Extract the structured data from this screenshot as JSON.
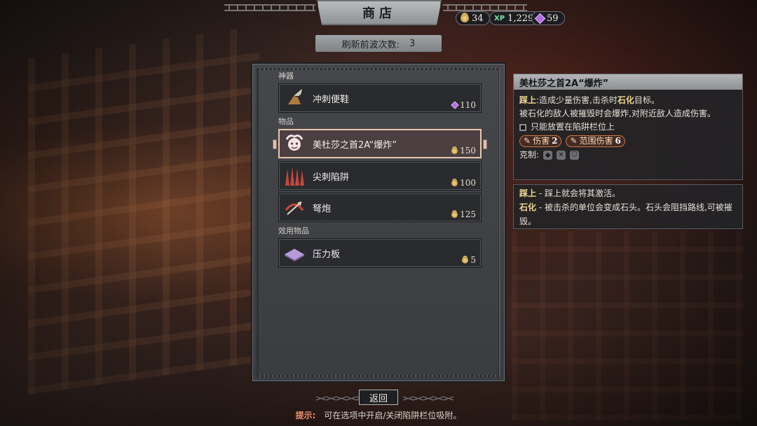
{
  "header": {
    "title": "商店",
    "wave_label": "刷新前波次数:",
    "wave_count": "3"
  },
  "currencies": {
    "gold": "34",
    "xp_label": "XP",
    "xp": "1,229",
    "gems": "59"
  },
  "shop": {
    "sections": [
      {
        "label": "神器"
      },
      {
        "label": "物品"
      },
      {
        "label": "效用物品"
      }
    ],
    "items": [
      {
        "name": "冲刺便鞋",
        "price": "110",
        "currency": "gem",
        "icon": "winged-sandal-icon"
      },
      {
        "name": "美杜莎之首2A“爆炸”",
        "price": "150",
        "currency": "gold",
        "icon": "medusa-head-icon"
      },
      {
        "name": "尖刺陷阱",
        "price": "100",
        "currency": "gold",
        "icon": "spike-trap-icon"
      },
      {
        "name": "弩炮",
        "price": "125",
        "currency": "gold",
        "icon": "ballista-icon"
      },
      {
        "name": "压力板",
        "price": "5",
        "currency": "gold",
        "icon": "pressure-plate-icon"
      }
    ],
    "selected_index": 1
  },
  "tooltip": {
    "title": "美杜莎之首2A“爆炸”",
    "line1_kw": "踩上",
    "line1_a": ":造成少量伤害,击杀时",
    "line1_kw2": "石化",
    "line1_b": "目标。",
    "line2": "被石化的敌人被摧毁时会爆炸,对附近敌人造成伤害。",
    "note": "只能放置在陷阱栏位上",
    "tags": [
      {
        "label": "伤害",
        "value": "2"
      },
      {
        "label": "范围伤害",
        "value": "6"
      }
    ],
    "counter_label": "克制:"
  },
  "glossary": {
    "entries": [
      {
        "term": "踩上",
        "desc": " - 踩上就会将其激活。"
      },
      {
        "term": "石化",
        "desc": " - 被击杀的单位会变成石头。石头会阻挡路线,可被摧毁。"
      }
    ]
  },
  "footer": {
    "back_label": "返回",
    "hint_key": "提示:",
    "hint_text": "可在选项中开启/关闭陷阱栏位吸附。"
  },
  "colors": {
    "accent_hint": "#f38d6a",
    "keyword": "#f0d890",
    "selected_border": "#e8c9ad"
  }
}
